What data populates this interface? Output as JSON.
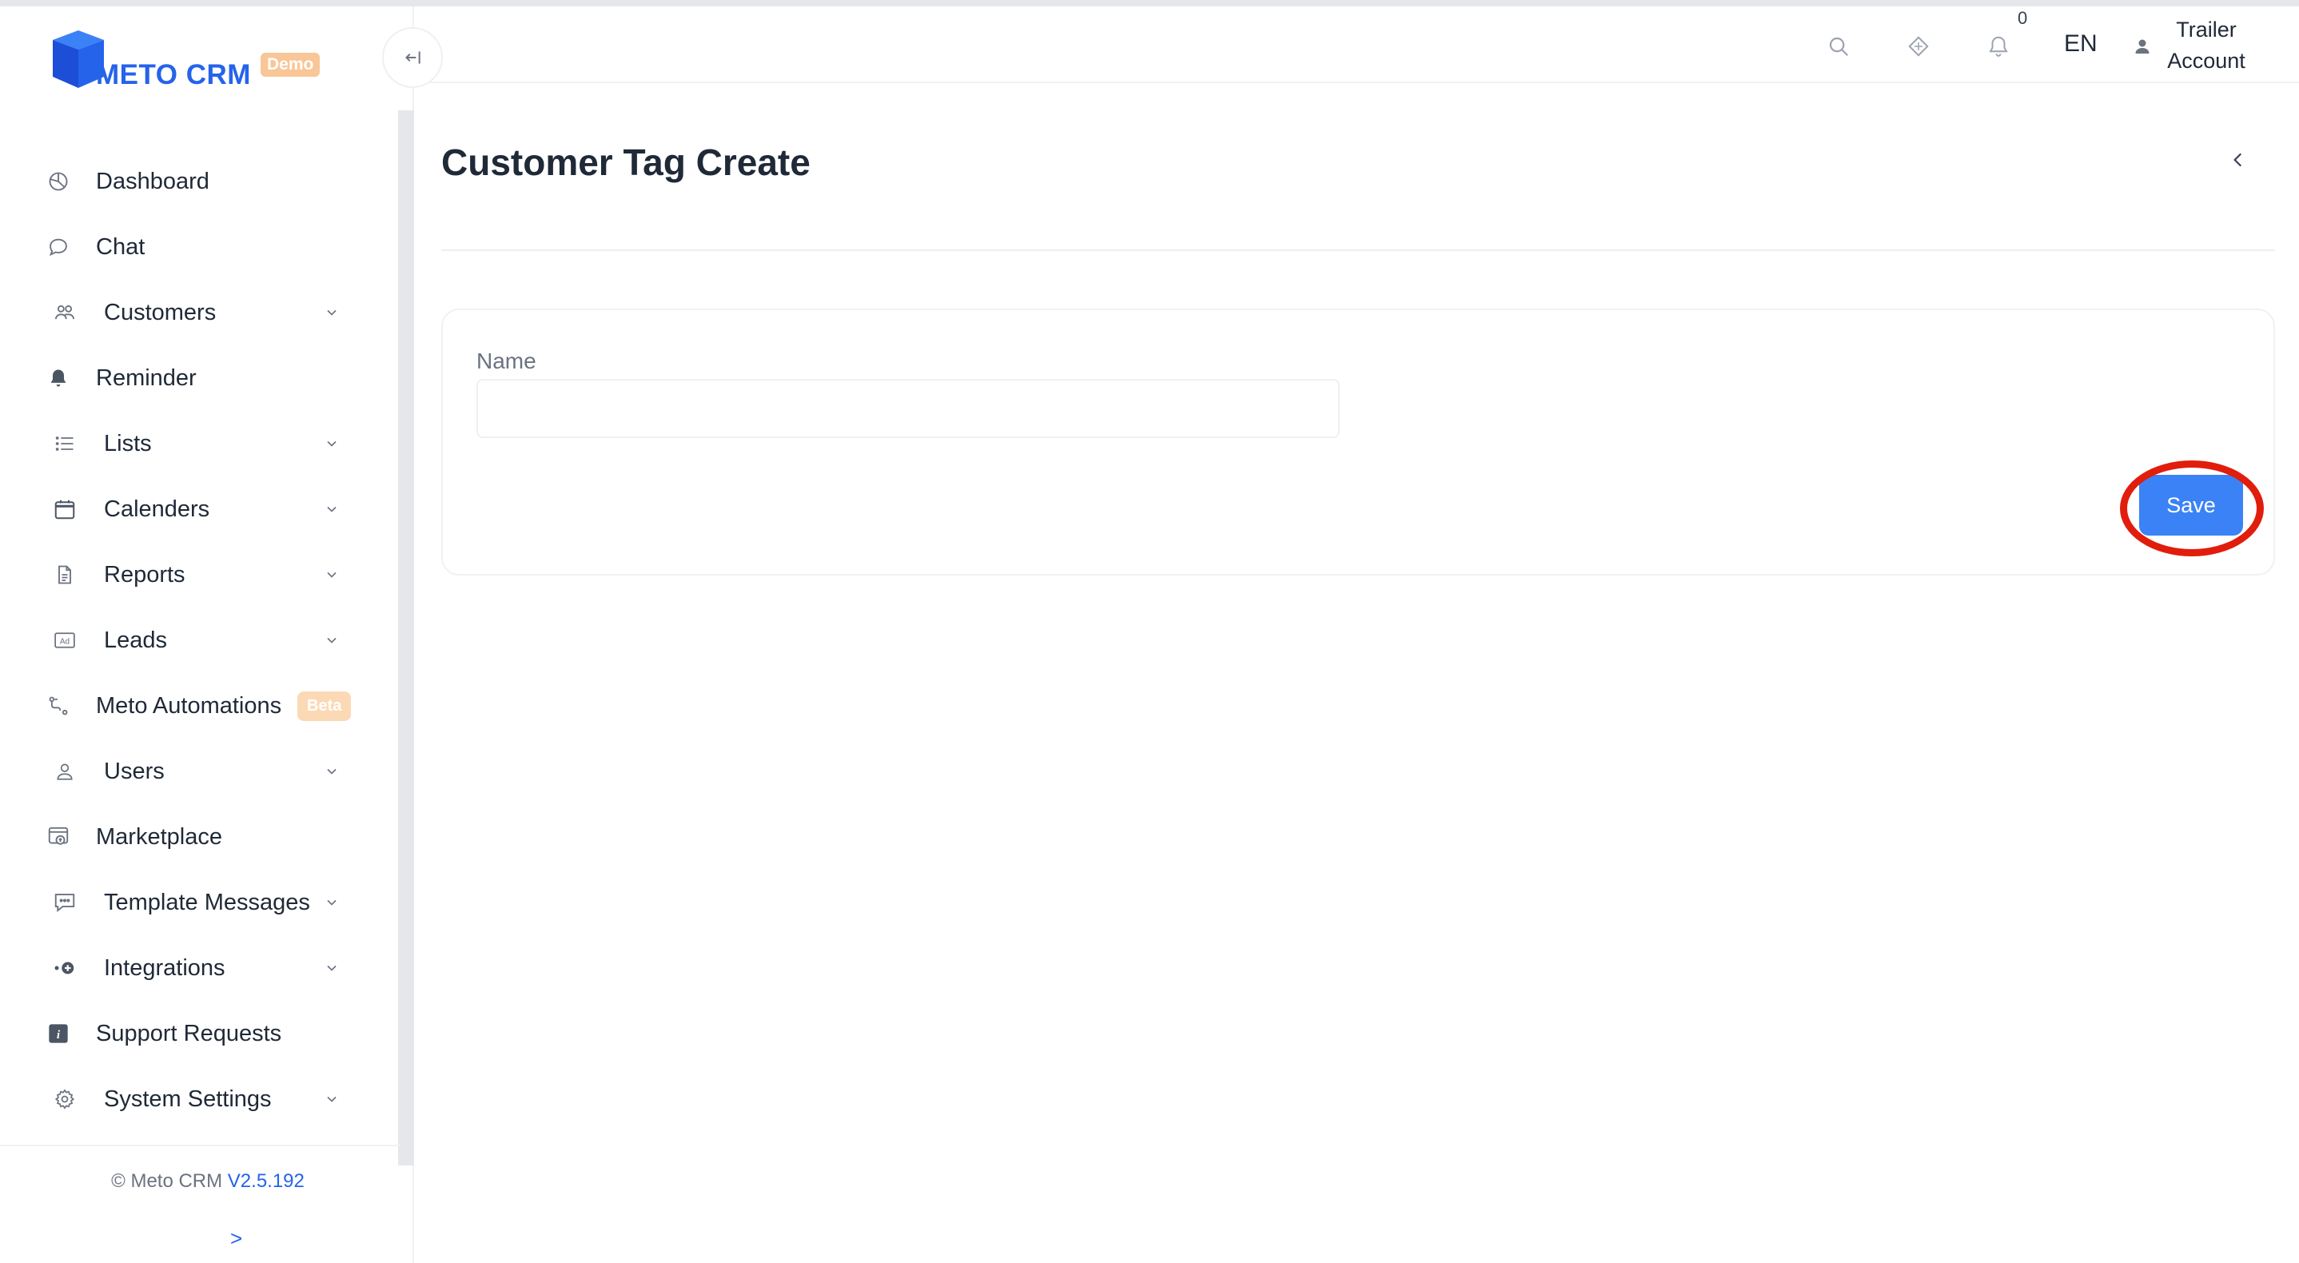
{
  "app": {
    "logo_text": "METO CRM",
    "logo_badge": "Demo",
    "brand_color": "#2563eb",
    "accent_color": "#3b82f6"
  },
  "sidebar": {
    "items": [
      {
        "label": "Dashboard",
        "icon": "dashboard-icon",
        "expandable": false
      },
      {
        "label": "Chat",
        "icon": "chat-icon",
        "expandable": false
      },
      {
        "label": "Customers",
        "icon": "customers-icon",
        "expandable": true
      },
      {
        "label": "Reminder",
        "icon": "bell-icon",
        "expandable": false
      },
      {
        "label": "Lists",
        "icon": "list-icon",
        "expandable": true
      },
      {
        "label": "Calenders",
        "icon": "calendar-icon",
        "expandable": true
      },
      {
        "label": "Reports",
        "icon": "report-icon",
        "expandable": true
      },
      {
        "label": "Leads",
        "icon": "ad-icon",
        "expandable": true
      },
      {
        "label": "Meto Automations",
        "icon": "automation-icon",
        "expandable": false,
        "badge": "Beta"
      },
      {
        "label": "Users",
        "icon": "user-icon",
        "expandable": true
      },
      {
        "label": "Marketplace",
        "icon": "marketplace-icon",
        "expandable": false
      },
      {
        "label": "Template Messages",
        "icon": "template-message-icon",
        "expandable": true
      },
      {
        "label": "Integrations",
        "icon": "integrations-icon",
        "expandable": true
      },
      {
        "label": "Support Requests",
        "icon": "info-icon",
        "expandable": false
      },
      {
        "label": "System Settings",
        "icon": "gear-icon",
        "expandable": true
      }
    ],
    "footer": {
      "copyright": "© Meto CRM",
      "version": "V2.5.192",
      "expand_symbol": ">"
    }
  },
  "header": {
    "notification_count": "0",
    "language": "EN",
    "user_line1": "Trailer",
    "user_line2": "Account"
  },
  "main": {
    "title": "Customer Tag Create",
    "form": {
      "name_label": "Name",
      "name_value": "",
      "name_placeholder": "",
      "save_label": "Save"
    }
  }
}
